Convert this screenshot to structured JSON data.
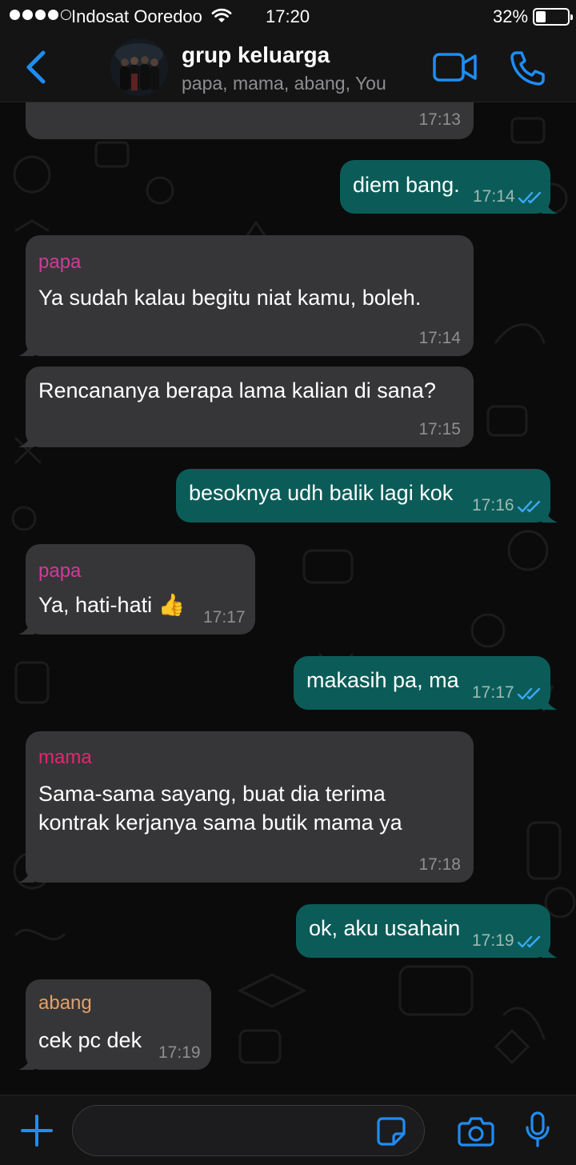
{
  "status_bar": {
    "carrier": "Indosat Ooredoo",
    "time": "17:20",
    "battery_percent": "32%",
    "battery_level": 0.32,
    "signal_bars_filled": 4,
    "signal_bars_total": 5
  },
  "header": {
    "title": "grup keluarga",
    "members": "papa, mama, abang, You"
  },
  "composer": {
    "placeholder": "",
    "value": ""
  },
  "colors": {
    "accent": "#1f8df5",
    "incoming_bubble": "#363638",
    "outgoing_bubble": "#0b5c58",
    "sender_papa": "#d23a9a",
    "sender_mama": "#e5266e",
    "sender_abang": "#e3a06a",
    "read_ticks": "#3da8f5"
  },
  "messages": [
    {
      "direction": "in",
      "sender": "",
      "text": "",
      "time": "17:13"
    },
    {
      "direction": "out",
      "text": "diem bang.",
      "time": "17:14",
      "status": "read"
    },
    {
      "direction": "in",
      "sender": "papa",
      "text": "Ya sudah kalau begitu niat kamu, boleh.",
      "time": "17:14"
    },
    {
      "direction": "in",
      "sender": "",
      "text": "Rencananya berapa lama kalian di sana?",
      "time": "17:15"
    },
    {
      "direction": "out",
      "text": "besoknya udh balik lagi kok",
      "time": "17:16",
      "status": "read"
    },
    {
      "direction": "in",
      "sender": "papa",
      "text": "Ya, hati-hati 👍",
      "time": "17:17"
    },
    {
      "direction": "out",
      "text": "makasih pa, ma",
      "time": "17:17",
      "status": "read"
    },
    {
      "direction": "in",
      "sender": "mama",
      "text_lines": [
        "Sama-sama sayang, buat dia terima",
        "kontrak kerjanya sama butik mama ya"
      ],
      "time": "17:18"
    },
    {
      "direction": "out",
      "text": "ok, aku usahain",
      "time": "17:19",
      "status": "read"
    },
    {
      "direction": "in",
      "sender": "abang",
      "text": "cek pc dek",
      "time": "17:19"
    }
  ]
}
